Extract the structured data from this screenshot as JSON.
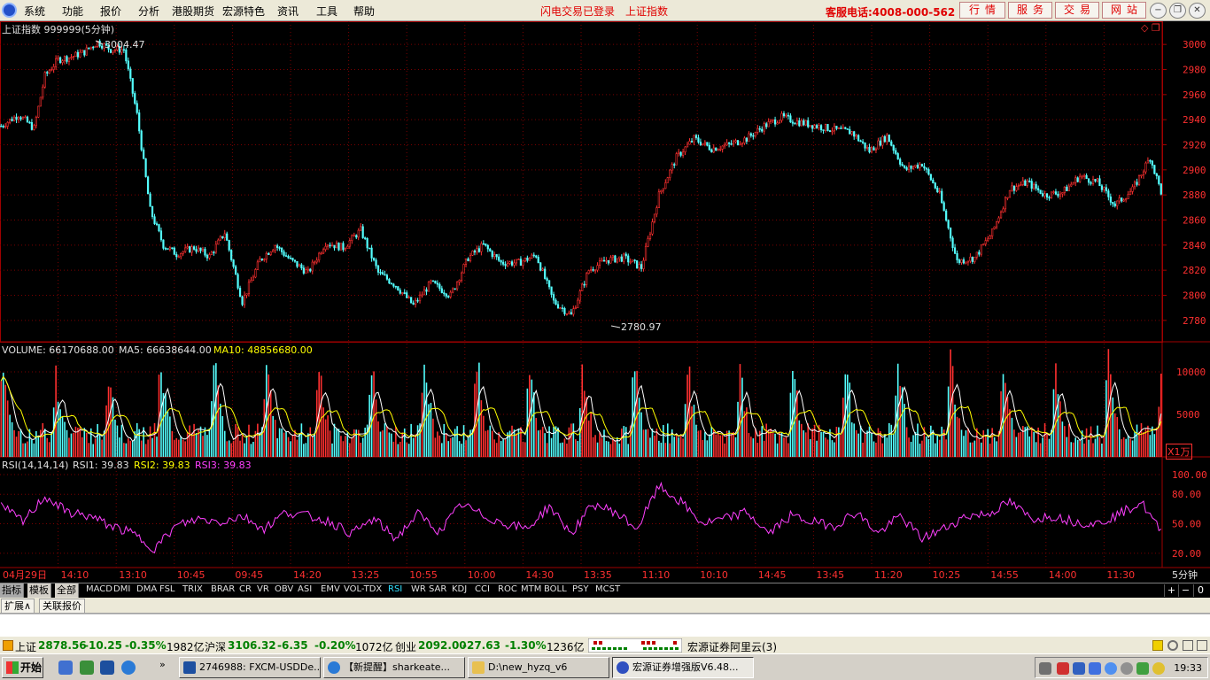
{
  "menubar": {
    "items": [
      "系统",
      "功能",
      "报价",
      "分析",
      "港股期货",
      "宏源特色",
      "资讯",
      "工具",
      "帮助"
    ],
    "hotlinks": [
      "闪电交易已登录",
      "上证指数"
    ],
    "service_phone": "客服电话:4008-000-562",
    "nav_buttons": [
      "行情",
      "服务",
      "交易",
      "网站"
    ],
    "window_buttons": [
      "−",
      "❐",
      "✕"
    ]
  },
  "chart": {
    "title": "上证指数 999999(5分钟)",
    "high_label": "3004.47",
    "low_label": "2780.97",
    "volume_title": {
      "volume": "VOLUME: 66170688.00",
      "ma5": "MA5: 66638644.00",
      "ma10": "MA10: 48856680.00"
    },
    "volume_unit": "X1万",
    "rsi_title": {
      "name": "RSI(14,14,14)",
      "rsi1": "RSI1: 39.83",
      "rsi2": "RSI2: 39.83",
      "rsi3": "RSI3: 39.83"
    },
    "period_label": "5分钟",
    "colors": {
      "grid": "#7a0000",
      "up": "#ff3030",
      "down": "#54ffff",
      "ma5": "#ffffff",
      "ma10": "#ffff00",
      "rsi": "#ff40ff",
      "axis_text": "#ff3030"
    }
  },
  "chart_data": {
    "type": "line",
    "title": "上证指数 999999(5分钟)",
    "ylim": [
      2770,
      3010
    ],
    "price_ticks": [
      3000,
      2980,
      2960,
      2940,
      2920,
      2900,
      2880,
      2860,
      2840,
      2820,
      2800,
      2780
    ],
    "volume_ticks": [
      10000,
      5000
    ],
    "rsi_ticks": [
      100,
      80,
      50,
      20
    ],
    "time_labels": [
      "04月29日",
      "14:10",
      "13:10",
      "10:45",
      "09:45",
      "14:20",
      "13:25",
      "10:55",
      "10:00",
      "14:30",
      "13:35",
      "11:10",
      "10:10",
      "14:45",
      "13:45",
      "11:20",
      "10:25",
      "14:55",
      "14:00",
      "11:30"
    ],
    "price_series": {
      "name": "上证指数",
      "x_index": [
        0,
        8,
        15,
        20,
        26,
        32,
        38,
        44,
        50,
        56,
        62,
        68,
        74,
        80,
        88,
        95,
        102,
        110,
        118,
        125,
        132,
        140,
        148,
        156,
        164,
        172,
        180,
        188,
        196,
        205,
        213,
        220,
        228,
        236,
        244,
        252,
        260,
        268,
        276,
        284,
        292,
        300,
        308,
        316,
        324,
        332,
        340,
        348,
        356,
        364,
        372,
        380,
        388,
        396,
        404,
        412,
        420,
        428,
        436,
        444,
        452,
        460,
        468,
        476,
        484,
        492,
        500,
        508,
        516,
        524,
        530
      ],
      "values": [
        2935,
        2944,
        2933,
        2975,
        2988,
        2990,
        2994,
        3002,
        2996,
        2996,
        2944,
        2868,
        2840,
        2833,
        2838,
        2831,
        2850,
        2795,
        2828,
        2840,
        2828,
        2818,
        2842,
        2838,
        2852,
        2818,
        2808,
        2792,
        2810,
        2800,
        2830,
        2840,
        2826,
        2826,
        2832,
        2795,
        2784,
        2820,
        2828,
        2830,
        2822,
        2880,
        2910,
        2925,
        2917,
        2920,
        2925,
        2935,
        2942,
        2938,
        2935,
        2932,
        2930,
        2915,
        2927,
        2900,
        2905,
        2880,
        2827,
        2830,
        2850,
        2885,
        2890,
        2880,
        2882,
        2895,
        2890,
        2872,
        2884,
        2910,
        2877
      ]
    },
    "rsi_series": {
      "name": "RSI1",
      "x_index": [
        0,
        10,
        20,
        30,
        40,
        50,
        60,
        70,
        80,
        90,
        100,
        110,
        120,
        130,
        140,
        150,
        160,
        170,
        180,
        190,
        200,
        210,
        220,
        230,
        240,
        250,
        260,
        270,
        280,
        290,
        300,
        310,
        320,
        330,
        340,
        350,
        360,
        370,
        380,
        390,
        400,
        410,
        420,
        430,
        440,
        450,
        460,
        470,
        480,
        490,
        500,
        510,
        520,
        530
      ],
      "values": [
        68,
        52,
        78,
        62,
        58,
        48,
        40,
        25,
        48,
        55,
        52,
        58,
        45,
        62,
        58,
        52,
        40,
        55,
        35,
        60,
        42,
        70,
        58,
        50,
        45,
        68,
        40,
        70,
        62,
        45,
        88,
        72,
        50,
        55,
        62,
        40,
        58,
        52,
        48,
        62,
        40,
        58,
        35,
        45,
        58,
        60,
        72,
        55,
        58,
        52,
        50,
        60,
        72,
        38
      ]
    }
  },
  "tabs": {
    "lead": [
      "指标",
      "模板",
      "全部"
    ],
    "indicators": [
      "MACD",
      "DMI",
      "DMA",
      "FSL",
      "TRIX",
      "BRAR",
      "CR",
      "VR",
      "OBV",
      "ASI",
      "EMV",
      "VOL-TDX",
      "RSI",
      "WR",
      "SAR",
      "KDJ",
      "CCI",
      "ROC",
      "MTM",
      "BOLL",
      "PSY",
      "MCST"
    ],
    "active": "RSI",
    "small_buttons": [
      "+",
      "−",
      "0"
    ]
  },
  "ext_tabs": [
    "扩展∧",
    "关联报价"
  ],
  "status": {
    "sh_name": "上证",
    "sh_val": "2878.56",
    "sh_chg": "-10.25",
    "sh_pct": "-0.35%",
    "sh_amt": "1982亿",
    "sz_name": "沪深",
    "sz_val": "3106.32",
    "sz_chg": "-6.35",
    "sz_pct": "-0.20%",
    "sz_amt": "1072亿",
    "cy_name": "创业",
    "cy_val": "2092.00",
    "cy_chg": "-27.63",
    "cy_pct": "-1.30%",
    "cy_amt": "1236亿",
    "server": "宏源证券阿里云(3)"
  },
  "taskbar": {
    "start": "开始",
    "buttons": [
      "2746988: FXCM-USDDe...",
      "【新提醒】sharkeate...",
      "D:\\new_hyzq_v6",
      "宏源证券增强版V6.48..."
    ],
    "clock": "19:33"
  }
}
